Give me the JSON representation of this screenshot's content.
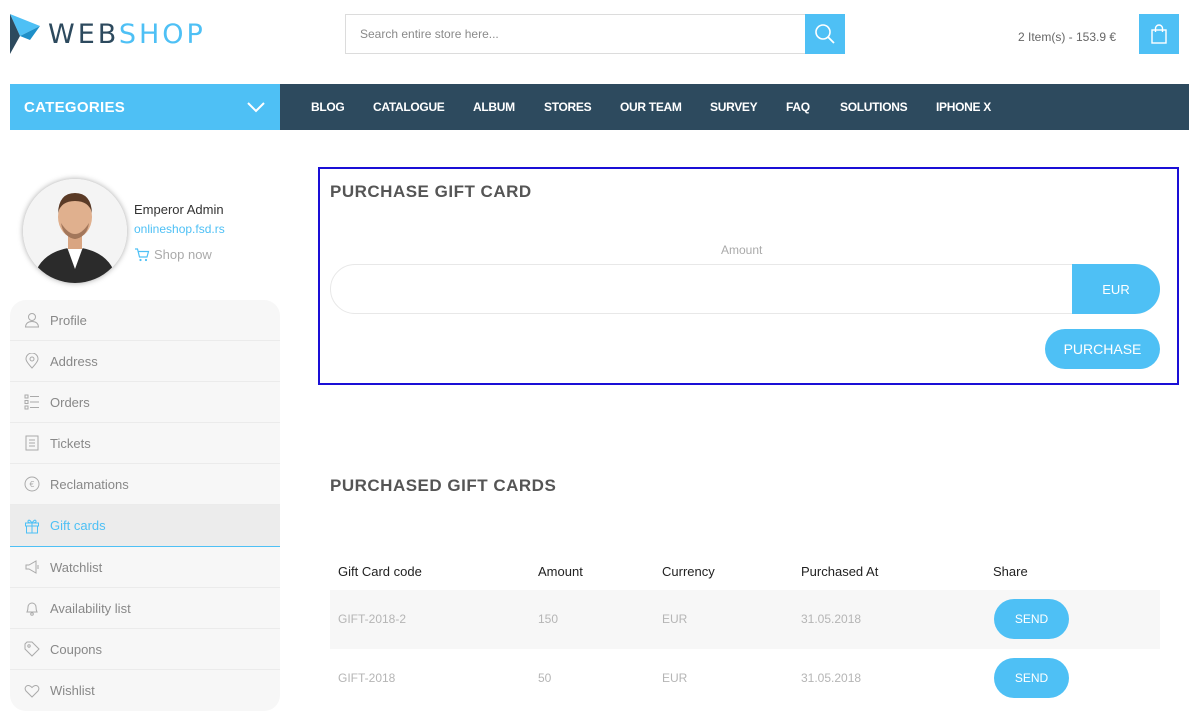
{
  "header": {
    "logo_part1": "WEB",
    "logo_part2": "SHOP",
    "search_placeholder": "Search entire store here...",
    "cart_summary": "2 Item(s) - 153.9 €"
  },
  "nav": {
    "categories_label": "CATEGORIES",
    "items": [
      "BLOG",
      "CATALOGUE",
      "ALBUM",
      "STORES",
      "OUR TEAM",
      "SURVEY",
      "FAQ",
      "SOLUTIONS",
      "IPHONE X"
    ]
  },
  "profile": {
    "name": "Emperor Admin",
    "site": "onlineshop.fsd.rs",
    "shop_now": "Shop now"
  },
  "sidebar": {
    "items": [
      {
        "label": "Profile",
        "icon": "user-icon"
      },
      {
        "label": "Address",
        "icon": "map-pin-icon"
      },
      {
        "label": "Orders",
        "icon": "list-icon"
      },
      {
        "label": "Tickets",
        "icon": "ticket-icon"
      },
      {
        "label": "Reclamations",
        "icon": "euro-circle-icon"
      },
      {
        "label": "Gift cards",
        "icon": "gift-icon",
        "active": true
      },
      {
        "label": "Watchlist",
        "icon": "megaphone-icon"
      },
      {
        "label": "Availability list",
        "icon": "bell-icon"
      },
      {
        "label": "Coupons",
        "icon": "tag-icon"
      },
      {
        "label": "Wishlist",
        "icon": "heart-icon"
      }
    ]
  },
  "purchase": {
    "title": "PURCHASE GIFT CARD",
    "amount_label": "Amount",
    "amount_value": "",
    "currency_label": "EUR",
    "purchase_label": "PURCHASE"
  },
  "purchased": {
    "title": "PURCHASED GIFT CARDS",
    "columns": [
      "Gift Card code",
      "Amount",
      "Currency",
      "Purchased At",
      "Share"
    ],
    "rows": [
      {
        "code": "GIFT-2018-2",
        "amount": "150",
        "currency": "EUR",
        "date": "31.05.2018",
        "share": "SEND"
      },
      {
        "code": "GIFT-2018",
        "amount": "50",
        "currency": "EUR",
        "date": "31.05.2018",
        "share": "SEND"
      }
    ]
  },
  "colors": {
    "accent": "#4ec0f5",
    "nav_bg": "#2d4a5e",
    "highlight_border": "#1a0fd6"
  }
}
